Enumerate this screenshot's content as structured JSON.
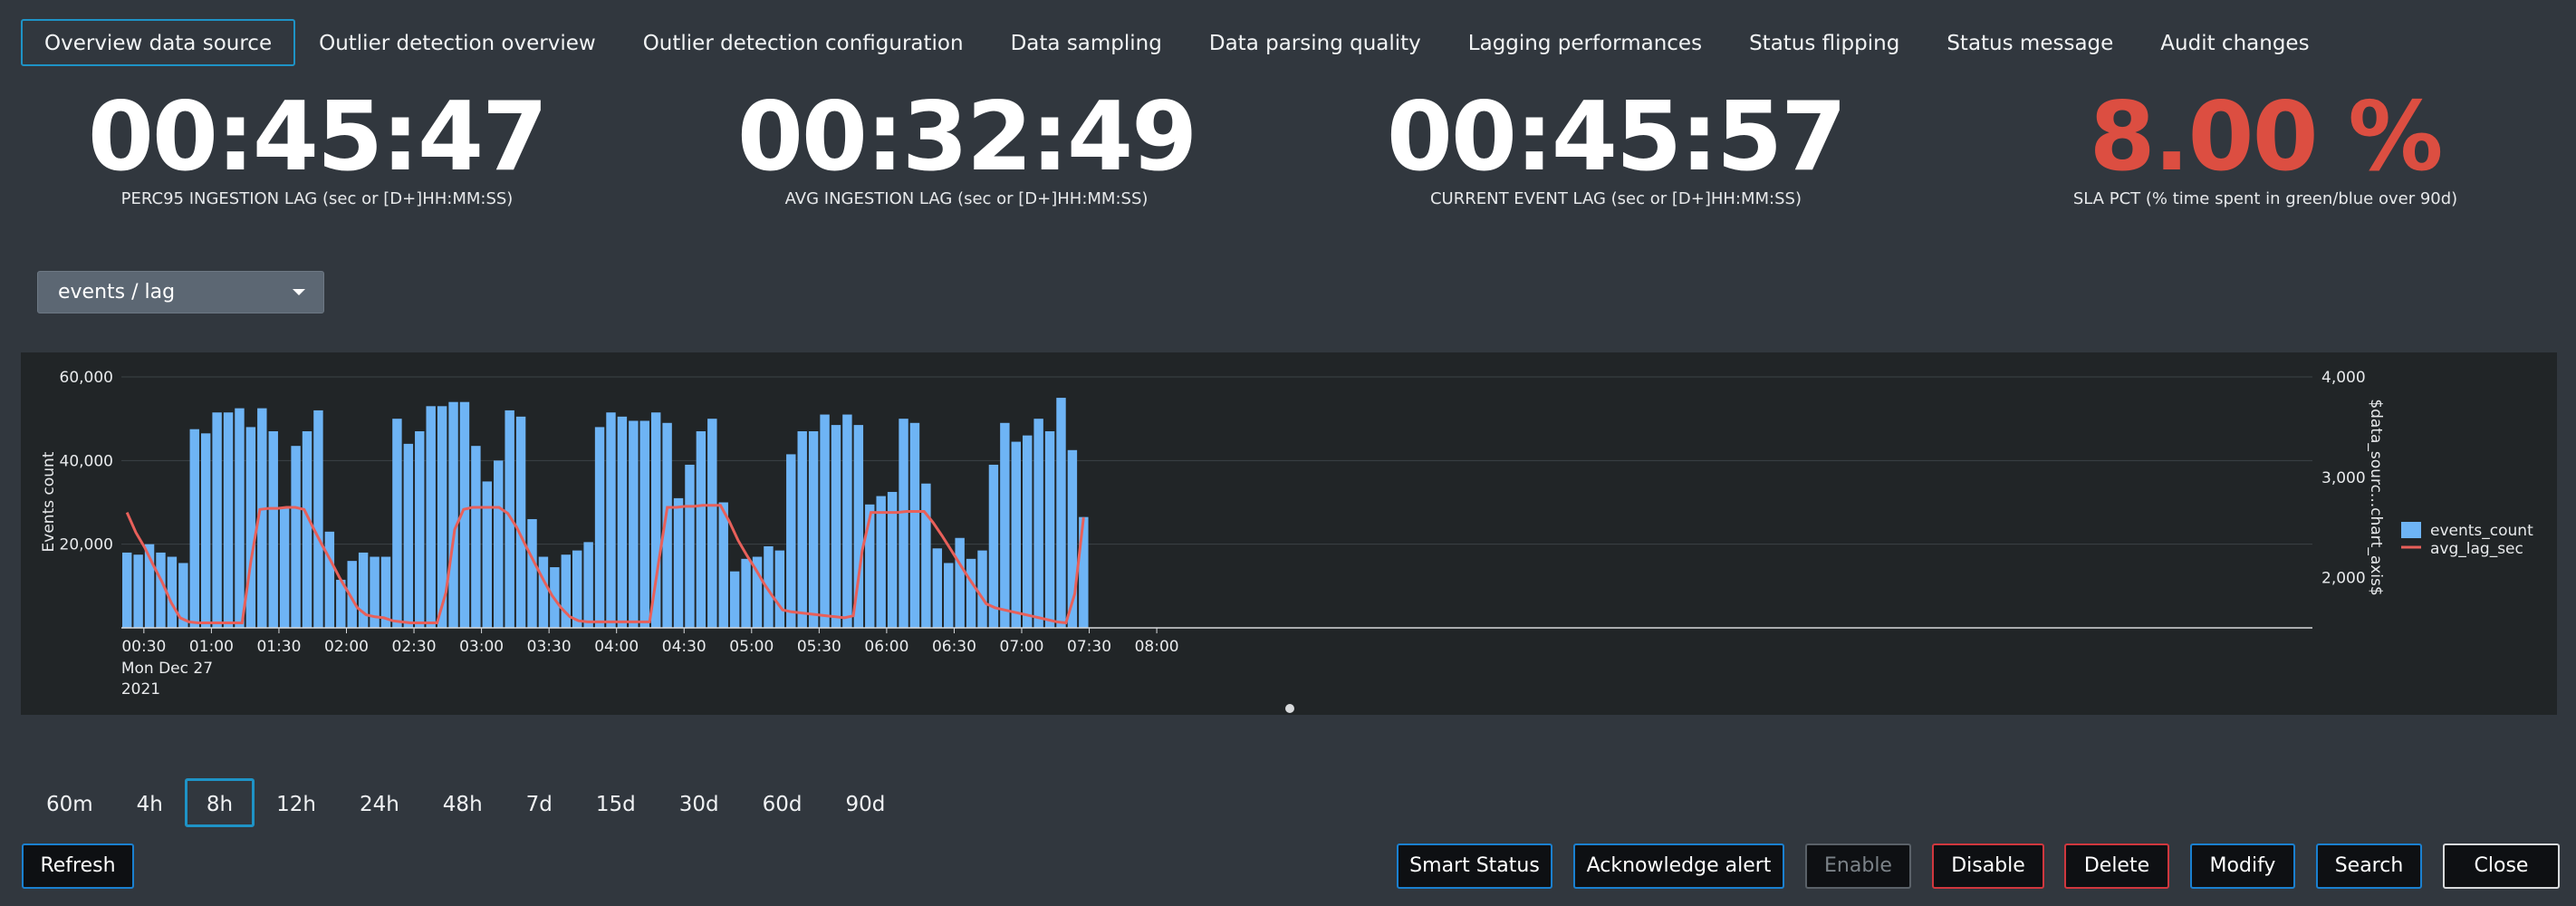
{
  "tabs": [
    {
      "label": "Overview data source",
      "active": true
    },
    {
      "label": "Outlier detection overview"
    },
    {
      "label": "Outlier detection configuration"
    },
    {
      "label": "Data sampling"
    },
    {
      "label": "Data parsing quality"
    },
    {
      "label": "Lagging performances"
    },
    {
      "label": "Status flipping"
    },
    {
      "label": "Status message"
    },
    {
      "label": "Audit changes"
    }
  ],
  "kpis": [
    {
      "value": "00:45:47",
      "label": "PERC95 INGESTION LAG (sec or [D+]HH:MM:SS)",
      "color": "#ffffff"
    },
    {
      "value": "00:32:49",
      "label": "AVG INGESTION LAG (sec or [D+]HH:MM:SS)",
      "color": "#ffffff"
    },
    {
      "value": "00:45:57",
      "label": "CURRENT EVENT LAG (sec or [D+]HH:MM:SS)",
      "color": "#ffffff"
    },
    {
      "value": "8.00 %",
      "label": "SLA PCT (% time spent in green/blue over 90d)",
      "color": "#dc4e41"
    }
  ],
  "metric_select": {
    "value": "events / lag"
  },
  "chart_data": {
    "type": "bar",
    "combo": "bar + line (secondary axis)",
    "ylabel": "Events count",
    "y2label": "$data_sourc...chart_axis$",
    "ylim": [
      0,
      60000
    ],
    "y2lim": [
      1500,
      4000
    ],
    "yticks": [
      "20,000",
      "40,000",
      "60,000"
    ],
    "y2ticks": [
      "2,000",
      "3,000",
      "4,000"
    ],
    "xticks": [
      "00:30",
      "01:00",
      "01:30",
      "02:00",
      "02:30",
      "03:00",
      "03:30",
      "04:00",
      "04:30",
      "05:00",
      "05:30",
      "06:00",
      "06:30",
      "07:00",
      "07:30",
      "08:00"
    ],
    "xtick_sub": [
      "Mon Dec 27",
      "2021"
    ],
    "x_start": "00:20",
    "interval_minutes": 5,
    "legend_position": "right",
    "grid": true,
    "series": [
      {
        "name": "events_count",
        "type": "bar",
        "color": "#6eb4f5",
        "values": [
          18000,
          17500,
          20000,
          18000,
          17000,
          15500,
          47500,
          46500,
          51500,
          51500,
          52500,
          48000,
          52500,
          47000,
          28500,
          43500,
          47000,
          52000,
          23000,
          11500,
          16000,
          18000,
          17000,
          17000,
          50000,
          44000,
          47000,
          53000,
          53000,
          54000,
          54000,
          43500,
          35000,
          40000,
          52000,
          50500,
          26000,
          17000,
          14500,
          17500,
          18500,
          20500,
          48000,
          51500,
          50500,
          49500,
          49500,
          51500,
          49000,
          31000,
          39000,
          47000,
          50000,
          30000,
          13500,
          16500,
          17000,
          19500,
          18500,
          41500,
          47000,
          47000,
          51000,
          48500,
          51000,
          48500,
          29500,
          31500,
          32500,
          50000,
          49000,
          34500,
          19000,
          15500,
          21500,
          16500,
          18500,
          39000,
          49000,
          44500,
          46000,
          50000,
          47000,
          55000,
          42500,
          26500
        ]
      },
      {
        "name": "avg_lag_sec",
        "type": "line",
        "color": "#e8605a",
        "values": [
          2650,
          2450,
          2300,
          2120,
          1950,
          1750,
          1600,
          1560,
          1550,
          1550,
          1550,
          1550,
          1550,
          1550,
          2170,
          2680,
          2690,
          2690,
          2700,
          2700,
          2680,
          2500,
          2330,
          2170,
          2000,
          1850,
          1700,
          1630,
          1610,
          1600,
          1570,
          1560,
          1550,
          1550,
          1550,
          1550,
          1850,
          2480,
          2680,
          2700,
          2700,
          2700,
          2700,
          2640,
          2500,
          2320,
          2150,
          1980,
          1820,
          1700,
          1610,
          1570,
          1560,
          1560,
          1560,
          1560,
          1560,
          1560,
          1560,
          1560,
          2140,
          2700,
          2700,
          2710,
          2710,
          2720,
          2720,
          2720,
          2560,
          2370,
          2220,
          2080,
          1930,
          1800,
          1680,
          1660,
          1650,
          1640,
          1630,
          1620,
          1610,
          1600,
          1620,
          2270,
          2650,
          2650,
          2650,
          2650,
          2660,
          2660,
          2660,
          2550,
          2420,
          2280,
          2140,
          2000,
          1870,
          1740,
          1700,
          1680,
          1660,
          1640,
          1620,
          1600,
          1580,
          1560,
          1550,
          1840,
          2600
        ]
      }
    ]
  },
  "time_ranges": [
    {
      "label": "60m"
    },
    {
      "label": "4h"
    },
    {
      "label": "8h",
      "active": true
    },
    {
      "label": "12h"
    },
    {
      "label": "24h"
    },
    {
      "label": "48h"
    },
    {
      "label": "7d"
    },
    {
      "label": "15d"
    },
    {
      "label": "30d"
    },
    {
      "label": "60d"
    },
    {
      "label": "90d"
    }
  ],
  "buttons": {
    "refresh": "Refresh",
    "smart_status": "Smart Status",
    "acknowledge": "Acknowledge alert",
    "enable": "Enable",
    "disable": "Disable",
    "delete": "Delete",
    "modify": "Modify",
    "search": "Search",
    "close": "Close"
  }
}
